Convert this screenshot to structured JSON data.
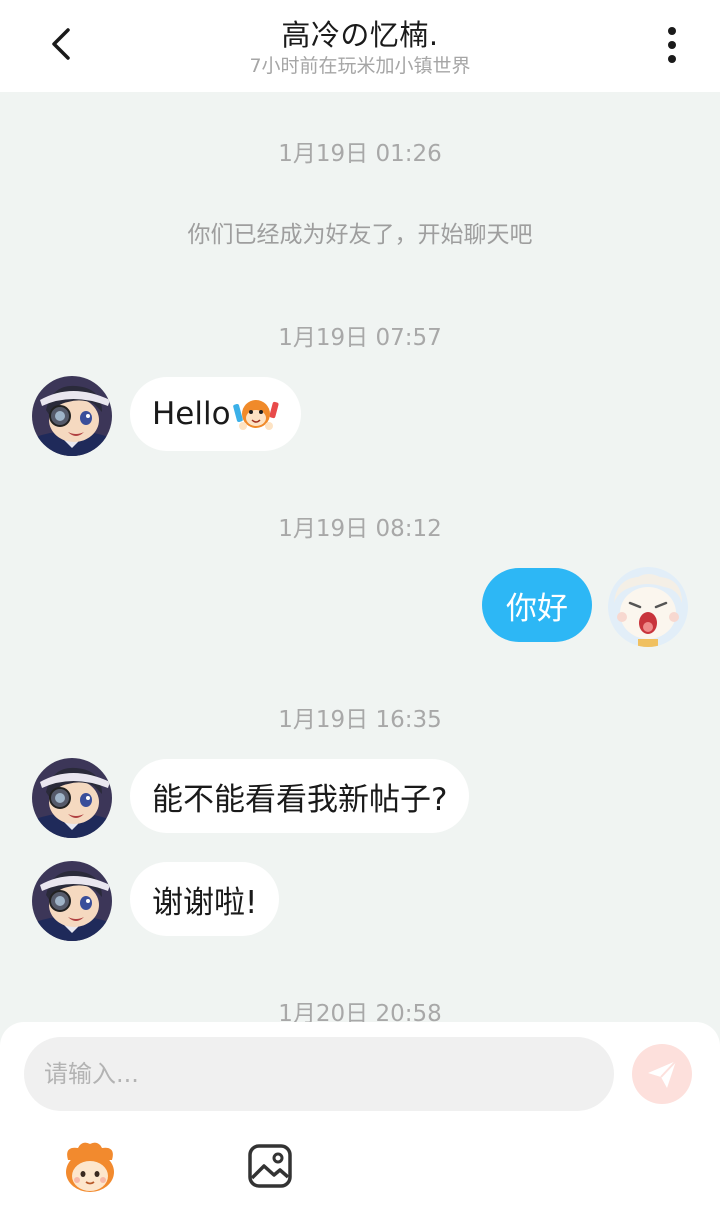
{
  "header": {
    "title": "高冷の忆楠.",
    "subtitle": "7小时前在玩米加小镇世界"
  },
  "messages": {
    "ts1": "1月19日 01:26",
    "system": "你们已经成为好友了，开始聊天吧",
    "ts2": "1月19日 07:57",
    "msg1": "Hello",
    "ts3": "1月19日 08:12",
    "msg2": "你好",
    "ts4": "1月19日 16:35",
    "msg3": "能不能看看我新帖子?",
    "msg4": "谢谢啦!",
    "ts5": "1月20日 20:58"
  },
  "composer": {
    "placeholder": "请输入..."
  },
  "icons": {
    "back": "chevron-left-icon",
    "more": "more-vertical-icon",
    "send": "send-icon",
    "emoji": "sticker-face-icon",
    "image": "image-icon"
  },
  "colors": {
    "background": "#f0f4f2",
    "outgoing_bubble": "#2db7f5",
    "incoming_bubble": "#ffffff",
    "send_button": "#fde0dc"
  }
}
